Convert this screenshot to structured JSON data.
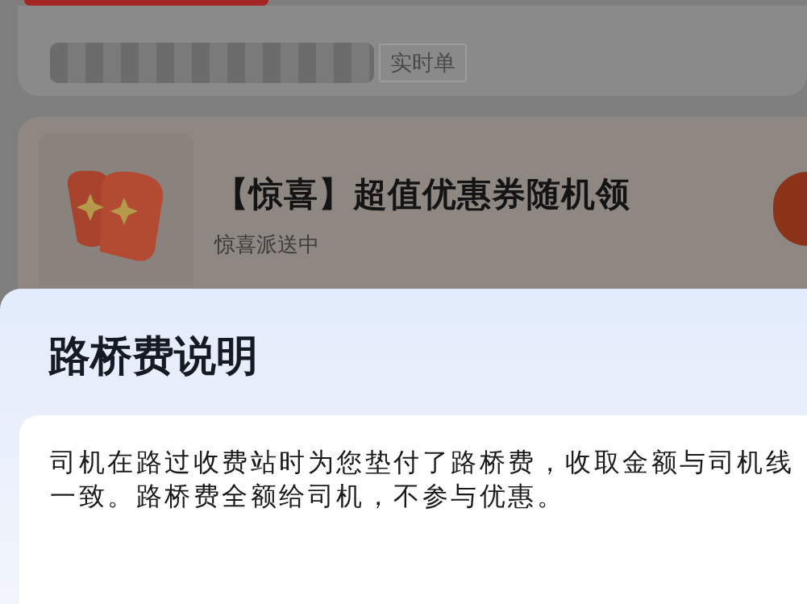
{
  "background_page": {
    "order_card": {
      "tag": "实时单"
    },
    "promo_card": {
      "title": "【惊喜】超值优惠券随机领",
      "subtitle": "惊喜派送中"
    }
  },
  "sheet": {
    "title": "路桥费说明",
    "body": "司机在路过收费站时为您垫付了路桥费，收取金额与司机线一致。路桥费全额给司机，不参与优惠。"
  }
}
